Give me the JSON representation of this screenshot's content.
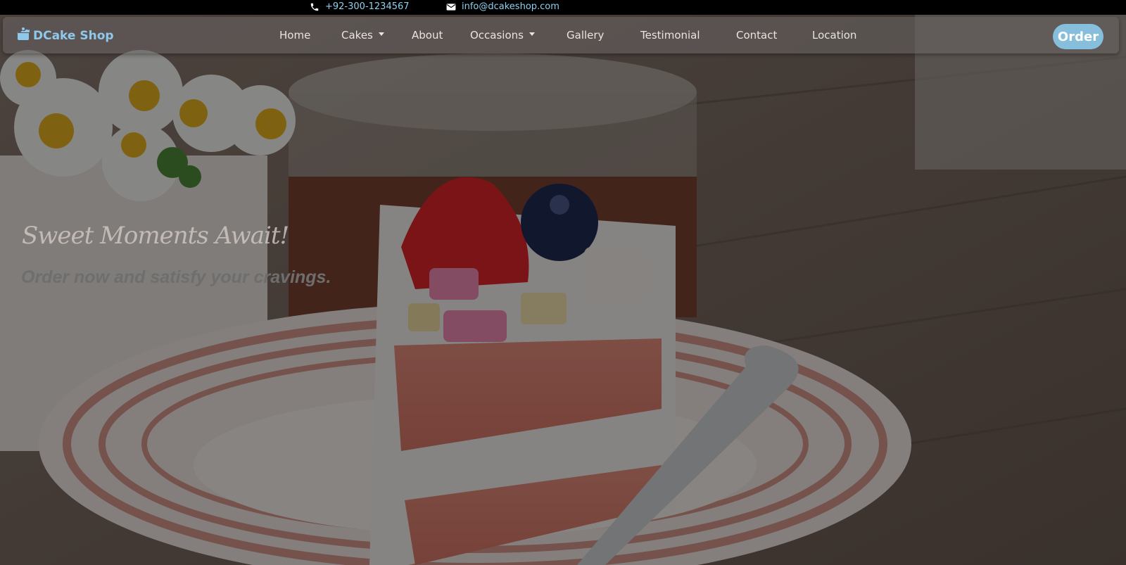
{
  "contact": {
    "phone": "+92-300-1234567",
    "email": "info@dcakeshop.com"
  },
  "brand": {
    "name": "DCake Shop",
    "icon": "cake-logo-icon",
    "color": "#8fc8ea"
  },
  "nav": {
    "items": [
      {
        "label": "Home",
        "dropdown": false
      },
      {
        "label": "Cakes",
        "dropdown": true
      },
      {
        "label": "About",
        "dropdown": false
      },
      {
        "label": "Occasions",
        "dropdown": true
      },
      {
        "label": "Gallery",
        "dropdown": false
      },
      {
        "label": "Testimonial",
        "dropdown": false
      },
      {
        "label": "Contact",
        "dropdown": false
      },
      {
        "label": "Location",
        "dropdown": false
      }
    ],
    "cta_label": "Order",
    "cta_color": "#86bedb"
  },
  "hero": {
    "tagline": "Sweet Moments Await!",
    "subtitle": "Order now and satisfy your cravings.",
    "image": "cake-slice-photo"
  },
  "colors": {
    "topbar_bg": "#000000",
    "topbar_text": "#8fd0ee",
    "nav_text": "#e9e4de"
  }
}
